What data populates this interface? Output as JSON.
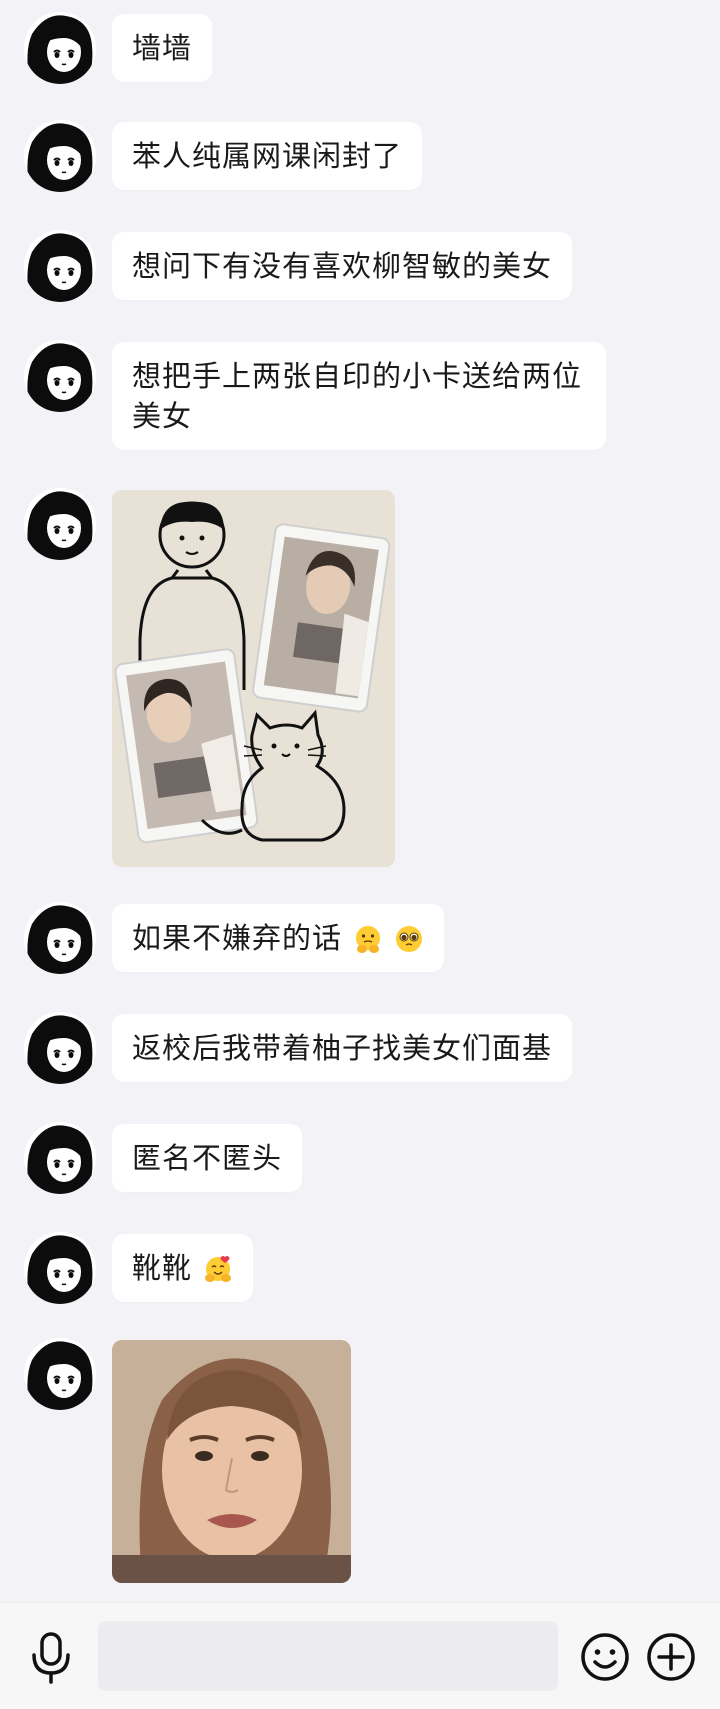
{
  "messages": [
    {
      "text": "墙墙"
    },
    {
      "text": "苯人纯属网课闲封了"
    },
    {
      "text": "想问下有没有喜欢柳智敏的美女"
    },
    {
      "text": "想把手上两张自印的小卡送给两位美女"
    },
    {
      "image": "photo-cards-on-cartoon-paper"
    },
    {
      "text": "如果不嫌弃的话",
      "emojis": [
        "pleading-hands-emoji",
        "teary-eyes-emoji"
      ]
    },
    {
      "text": "返校后我带着柚子找美女们面基"
    },
    {
      "text": "匿名不匿头"
    },
    {
      "text": "靴靴",
      "emojis": [
        "hugging-heart-emoji"
      ]
    },
    {
      "image": "crying-face-reaction-photo"
    }
  ],
  "input_bar": {
    "voice_icon": "microphone-icon",
    "emoji_icon": "smiley-icon",
    "more_icon": "plus-circle-icon",
    "text_value": ""
  },
  "colors": {
    "background": "#f3f2f7",
    "bubble": "#ffffff",
    "text": "#1a1a1a"
  }
}
